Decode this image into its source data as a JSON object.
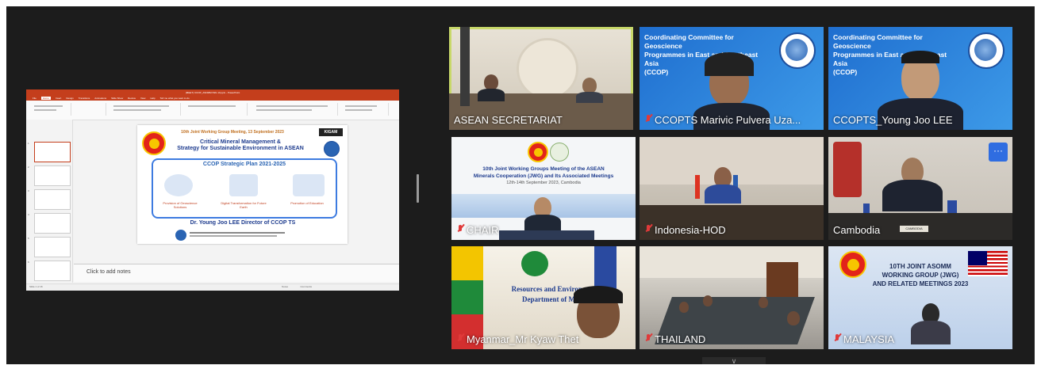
{
  "shared_screen": {
    "app_title": "(MEET) CCOP_ASOMM IWG 10.pptx - PowerPoint",
    "ribbon_tabs": [
      "File",
      "Home",
      "Insert",
      "Design",
      "Transitions",
      "Animations",
      "Slide Show",
      "Review",
      "View",
      "Help",
      "Tell me what you want to do"
    ],
    "active_tab": "Home",
    "slide": {
      "meeting_line": "10th Joint Working Group Meeting, 13 September 2023",
      "title_line1": "Critical Mineral Management &",
      "title_line2": "Strategy for Sustainable Environment in ASEAN",
      "plan_title": "CCOP Strategic Plan 2021-2025",
      "pillars": [
        "Provision of Geoscience Solutions",
        "Digital Transformation for Future Earth",
        "Promotion of Education"
      ],
      "speaker": "Dr. Young Joo LEE Director of CCOP TS",
      "logo_right": "KIGAM"
    },
    "notes_placeholder": "Click to add notes",
    "status_left": "Slide 1 of 16",
    "status_right_notes": "Notes",
    "status_right_comments": "Comments"
  },
  "participants": [
    {
      "name": "ASEAN SECRETARIAT",
      "muted": false,
      "active_speaker": true
    },
    {
      "name": "CCOPTS Marivic Pulvera Uza...",
      "muted": true,
      "banner_line1": "Coordinating Committee for Geoscience",
      "banner_line2": "Programmes in East and Southeast Asia",
      "banner_line3": "(CCOP)"
    },
    {
      "name": "CCOPTS_Young Joo LEE",
      "muted": false,
      "banner_line1": "Coordinating Committee for Geoscience",
      "banner_line2": "Programmes in East and Southeast Asia",
      "banner_line3": "(CCOP)"
    },
    {
      "name": "CHAIR",
      "muted": true,
      "banner_line1": "10th Joint Working Groups Meeting of the ASEAN",
      "banner_line2": "Minerals Cooperation (JWG) and Its Associated Meetings",
      "banner_line3": "12th-14th September 2023, Cambodia"
    },
    {
      "name": "Indonesia-HOD",
      "muted": true
    },
    {
      "name": "Cambodia",
      "muted": false,
      "more_button": "···",
      "desk_sign": "CAMBODIA"
    },
    {
      "name": "Myanmar_Mr Kyaw Thet",
      "muted": true,
      "banner_line1": "Resources and Environment",
      "banner_line2": "Department of Mines"
    },
    {
      "name": "THAILAND",
      "muted": true
    },
    {
      "name": "MALAYSIA",
      "muted": true,
      "banner_line1": "10TH JOINT ASOMM",
      "banner_line2": "WORKING GROUP (JWG)",
      "banner_line3": "AND RELATED MEETINGS 2023"
    }
  ],
  "colors": {
    "accent_speaker": "#c8d86a",
    "mute_red": "#e03a3a",
    "ppt_red": "#c43e1c",
    "ccop_blue": "#1f6ecf"
  }
}
